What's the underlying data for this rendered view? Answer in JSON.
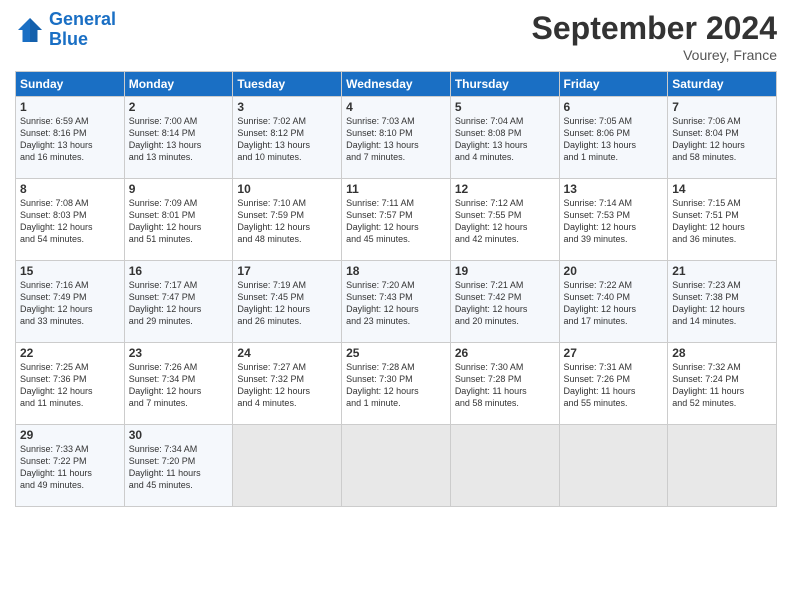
{
  "logo": {
    "line1": "General",
    "line2": "Blue"
  },
  "title": "September 2024",
  "location": "Vourey, France",
  "days_of_week": [
    "Sunday",
    "Monday",
    "Tuesday",
    "Wednesday",
    "Thursday",
    "Friday",
    "Saturday"
  ],
  "weeks": [
    [
      {
        "day": "1",
        "sunrise": "Sunrise: 6:59 AM",
        "sunset": "Sunset: 8:16 PM",
        "daylight": "Daylight: 13 hours",
        "minutes": "and 16 minutes."
      },
      {
        "day": "2",
        "sunrise": "Sunrise: 7:00 AM",
        "sunset": "Sunset: 8:14 PM",
        "daylight": "Daylight: 13 hours",
        "minutes": "and 13 minutes."
      },
      {
        "day": "3",
        "sunrise": "Sunrise: 7:02 AM",
        "sunset": "Sunset: 8:12 PM",
        "daylight": "Daylight: 13 hours",
        "minutes": "and 10 minutes."
      },
      {
        "day": "4",
        "sunrise": "Sunrise: 7:03 AM",
        "sunset": "Sunset: 8:10 PM",
        "daylight": "Daylight: 13 hours",
        "minutes": "and 7 minutes."
      },
      {
        "day": "5",
        "sunrise": "Sunrise: 7:04 AM",
        "sunset": "Sunset: 8:08 PM",
        "daylight": "Daylight: 13 hours",
        "minutes": "and 4 minutes."
      },
      {
        "day": "6",
        "sunrise": "Sunrise: 7:05 AM",
        "sunset": "Sunset: 8:06 PM",
        "daylight": "Daylight: 13 hours",
        "minutes": "and 1 minute."
      },
      {
        "day": "7",
        "sunrise": "Sunrise: 7:06 AM",
        "sunset": "Sunset: 8:04 PM",
        "daylight": "Daylight: 12 hours",
        "minutes": "and 58 minutes."
      }
    ],
    [
      {
        "day": "8",
        "sunrise": "Sunrise: 7:08 AM",
        "sunset": "Sunset: 8:03 PM",
        "daylight": "Daylight: 12 hours",
        "minutes": "and 54 minutes."
      },
      {
        "day": "9",
        "sunrise": "Sunrise: 7:09 AM",
        "sunset": "Sunset: 8:01 PM",
        "daylight": "Daylight: 12 hours",
        "minutes": "and 51 minutes."
      },
      {
        "day": "10",
        "sunrise": "Sunrise: 7:10 AM",
        "sunset": "Sunset: 7:59 PM",
        "daylight": "Daylight: 12 hours",
        "minutes": "and 48 minutes."
      },
      {
        "day": "11",
        "sunrise": "Sunrise: 7:11 AM",
        "sunset": "Sunset: 7:57 PM",
        "daylight": "Daylight: 12 hours",
        "minutes": "and 45 minutes."
      },
      {
        "day": "12",
        "sunrise": "Sunrise: 7:12 AM",
        "sunset": "Sunset: 7:55 PM",
        "daylight": "Daylight: 12 hours",
        "minutes": "and 42 minutes."
      },
      {
        "day": "13",
        "sunrise": "Sunrise: 7:14 AM",
        "sunset": "Sunset: 7:53 PM",
        "daylight": "Daylight: 12 hours",
        "minutes": "and 39 minutes."
      },
      {
        "day": "14",
        "sunrise": "Sunrise: 7:15 AM",
        "sunset": "Sunset: 7:51 PM",
        "daylight": "Daylight: 12 hours",
        "minutes": "and 36 minutes."
      }
    ],
    [
      {
        "day": "15",
        "sunrise": "Sunrise: 7:16 AM",
        "sunset": "Sunset: 7:49 PM",
        "daylight": "Daylight: 12 hours",
        "minutes": "and 33 minutes."
      },
      {
        "day": "16",
        "sunrise": "Sunrise: 7:17 AM",
        "sunset": "Sunset: 7:47 PM",
        "daylight": "Daylight: 12 hours",
        "minutes": "and 29 minutes."
      },
      {
        "day": "17",
        "sunrise": "Sunrise: 7:19 AM",
        "sunset": "Sunset: 7:45 PM",
        "daylight": "Daylight: 12 hours",
        "minutes": "and 26 minutes."
      },
      {
        "day": "18",
        "sunrise": "Sunrise: 7:20 AM",
        "sunset": "Sunset: 7:43 PM",
        "daylight": "Daylight: 12 hours",
        "minutes": "and 23 minutes."
      },
      {
        "day": "19",
        "sunrise": "Sunrise: 7:21 AM",
        "sunset": "Sunset: 7:42 PM",
        "daylight": "Daylight: 12 hours",
        "minutes": "and 20 minutes."
      },
      {
        "day": "20",
        "sunrise": "Sunrise: 7:22 AM",
        "sunset": "Sunset: 7:40 PM",
        "daylight": "Daylight: 12 hours",
        "minutes": "and 17 minutes."
      },
      {
        "day": "21",
        "sunrise": "Sunrise: 7:23 AM",
        "sunset": "Sunset: 7:38 PM",
        "daylight": "Daylight: 12 hours",
        "minutes": "and 14 minutes."
      }
    ],
    [
      {
        "day": "22",
        "sunrise": "Sunrise: 7:25 AM",
        "sunset": "Sunset: 7:36 PM",
        "daylight": "Daylight: 12 hours",
        "minutes": "and 11 minutes."
      },
      {
        "day": "23",
        "sunrise": "Sunrise: 7:26 AM",
        "sunset": "Sunset: 7:34 PM",
        "daylight": "Daylight: 12 hours",
        "minutes": "and 7 minutes."
      },
      {
        "day": "24",
        "sunrise": "Sunrise: 7:27 AM",
        "sunset": "Sunset: 7:32 PM",
        "daylight": "Daylight: 12 hours",
        "minutes": "and 4 minutes."
      },
      {
        "day": "25",
        "sunrise": "Sunrise: 7:28 AM",
        "sunset": "Sunset: 7:30 PM",
        "daylight": "Daylight: 12 hours",
        "minutes": "and 1 minute."
      },
      {
        "day": "26",
        "sunrise": "Sunrise: 7:30 AM",
        "sunset": "Sunset: 7:28 PM",
        "daylight": "Daylight: 11 hours",
        "minutes": "and 58 minutes."
      },
      {
        "day": "27",
        "sunrise": "Sunrise: 7:31 AM",
        "sunset": "Sunset: 7:26 PM",
        "daylight": "Daylight: 11 hours",
        "minutes": "and 55 minutes."
      },
      {
        "day": "28",
        "sunrise": "Sunrise: 7:32 AM",
        "sunset": "Sunset: 7:24 PM",
        "daylight": "Daylight: 11 hours",
        "minutes": "and 52 minutes."
      }
    ],
    [
      {
        "day": "29",
        "sunrise": "Sunrise: 7:33 AM",
        "sunset": "Sunset: 7:22 PM",
        "daylight": "Daylight: 11 hours",
        "minutes": "and 49 minutes."
      },
      {
        "day": "30",
        "sunrise": "Sunrise: 7:34 AM",
        "sunset": "Sunset: 7:20 PM",
        "daylight": "Daylight: 11 hours",
        "minutes": "and 45 minutes."
      },
      null,
      null,
      null,
      null,
      null
    ]
  ]
}
